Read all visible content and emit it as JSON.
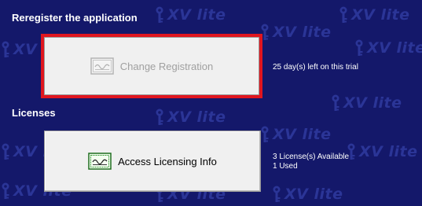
{
  "registration": {
    "section_title": "Reregister the application",
    "button_label": "Change Registration",
    "button_state": "disabled",
    "trial_status": "25 day(s) left on this trial"
  },
  "licenses": {
    "section_title": "Licenses",
    "button_label": "Access Licensing Info",
    "available": "3 License(s) Available",
    "used": "1 Used"
  },
  "watermark": {
    "text": "XV lite",
    "icon": "key-icon",
    "color": "#2b3597"
  },
  "colors": {
    "background": "#14186a",
    "focus_border": "#e0161f",
    "button_face": "#f0f0f0"
  }
}
